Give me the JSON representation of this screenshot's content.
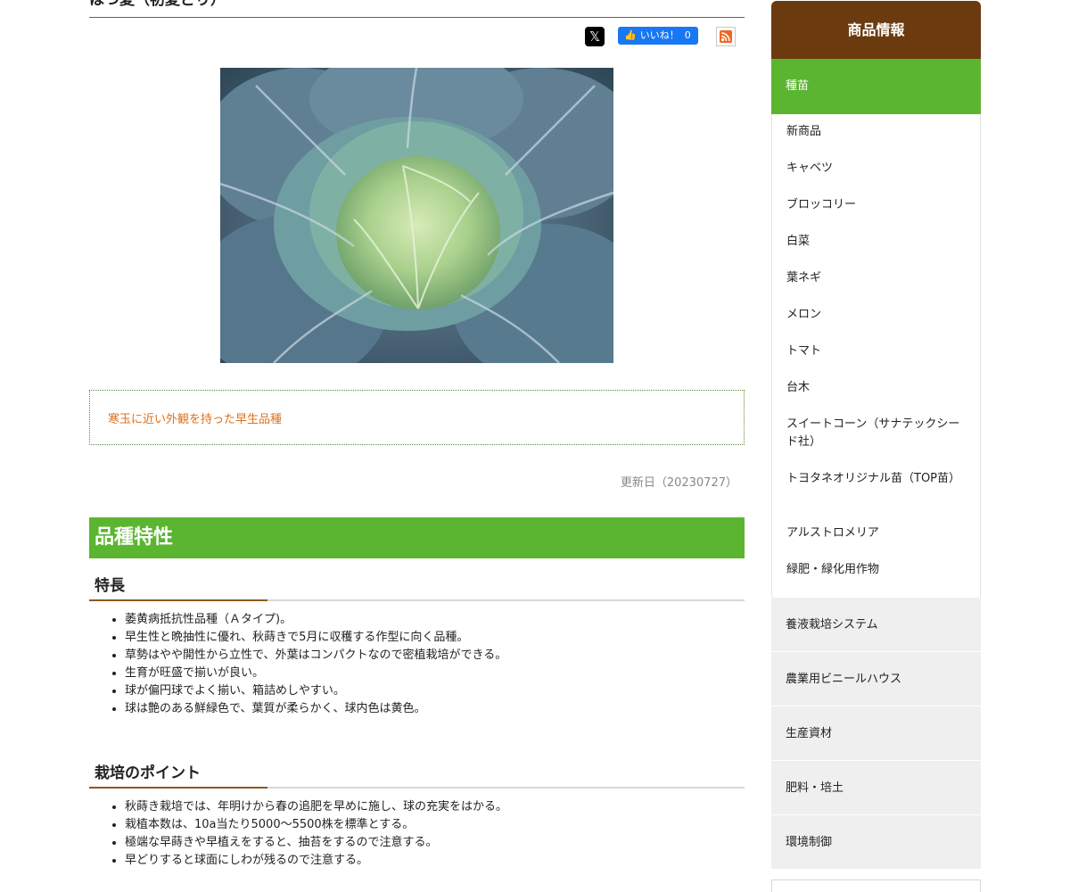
{
  "page": {
    "title": "はつ夏（初夏どり）",
    "hero_alt": "cabbage",
    "catch": "寒玉に近い外観を持った早生品種",
    "updated": "更新日（20230727）"
  },
  "share": {
    "x_label": "𝕏",
    "fb_label": "いいね！",
    "fb_count": "0"
  },
  "section": {
    "title": "品種特性",
    "features": {
      "heading": "特長",
      "items": [
        "萎黄病抵抗性品種（Ａタイプ)。",
        "早生性と晩抽性に優れ、秋蒔きで5月に収穫する作型に向く品種。",
        "草勢はやや開性から立性で、外葉はコンパクトなので密植栽培ができる。",
        "生育が旺盛で揃いが良い。",
        "球が偏円球でよく揃い、箱詰めしやすい。",
        "球は艶のある鮮緑色で、葉質が柔らかく、球内色は黄色。"
      ]
    },
    "points": {
      "heading": "栽培のポイント",
      "items": [
        "秋蒔き栽培では、年明けから春の追肥を早めに施し、球の充実をはかる。",
        "栽植本数は、10a当たり5000〜5500株を標準とする。",
        "極端な早蒔きや早植えをすると、抽苔をするので注意する。",
        "早どりすると球面にしわが残るので注意する。"
      ]
    }
  },
  "sidebar": {
    "title": "商品情報",
    "active": "種苗",
    "sub_items": [
      "新商品",
      "キャベツ",
      "ブロッコリー",
      "白菜",
      "葉ネギ",
      "メロン",
      "トマト",
      "台木",
      "スイートコーン（サナテックシード社）",
      "トヨタネオリジナル苗（TOP苗）",
      "アルストロメリア",
      "緑肥・緑化用作物"
    ],
    "categories": [
      "養液栽培システム",
      "農業用ビニールハウス",
      "生産資材",
      "肥料・培土",
      "環境制御"
    ]
  },
  "colors": {
    "green": "#5bb531",
    "brown": "#6b3a0e",
    "accent_orange": "#e0701a"
  }
}
